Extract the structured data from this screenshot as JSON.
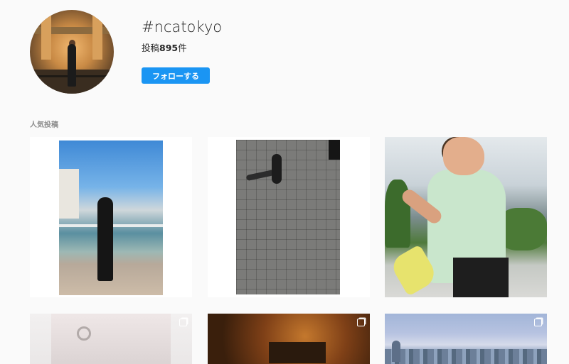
{
  "header": {
    "hashtag": "#ncatokyo",
    "posts_label": "投稿",
    "posts_count": "895",
    "posts_unit": "件",
    "follow_label": "フォローする"
  },
  "section": {
    "label": "人気投稿"
  },
  "colors": {
    "follow_button": "#1a95f3",
    "background": "#fafafa"
  },
  "grid": {
    "tiles": [
      {
        "name": "post-standing-woman",
        "multi": false
      },
      {
        "name": "post-runner-overhead",
        "multi": true
      },
      {
        "name": "post-stretching-woman",
        "multi": false
      },
      {
        "name": "post-interior",
        "multi": true
      },
      {
        "name": "post-autumn-trees",
        "multi": true
      },
      {
        "name": "post-city-skyline",
        "multi": true
      }
    ]
  }
}
